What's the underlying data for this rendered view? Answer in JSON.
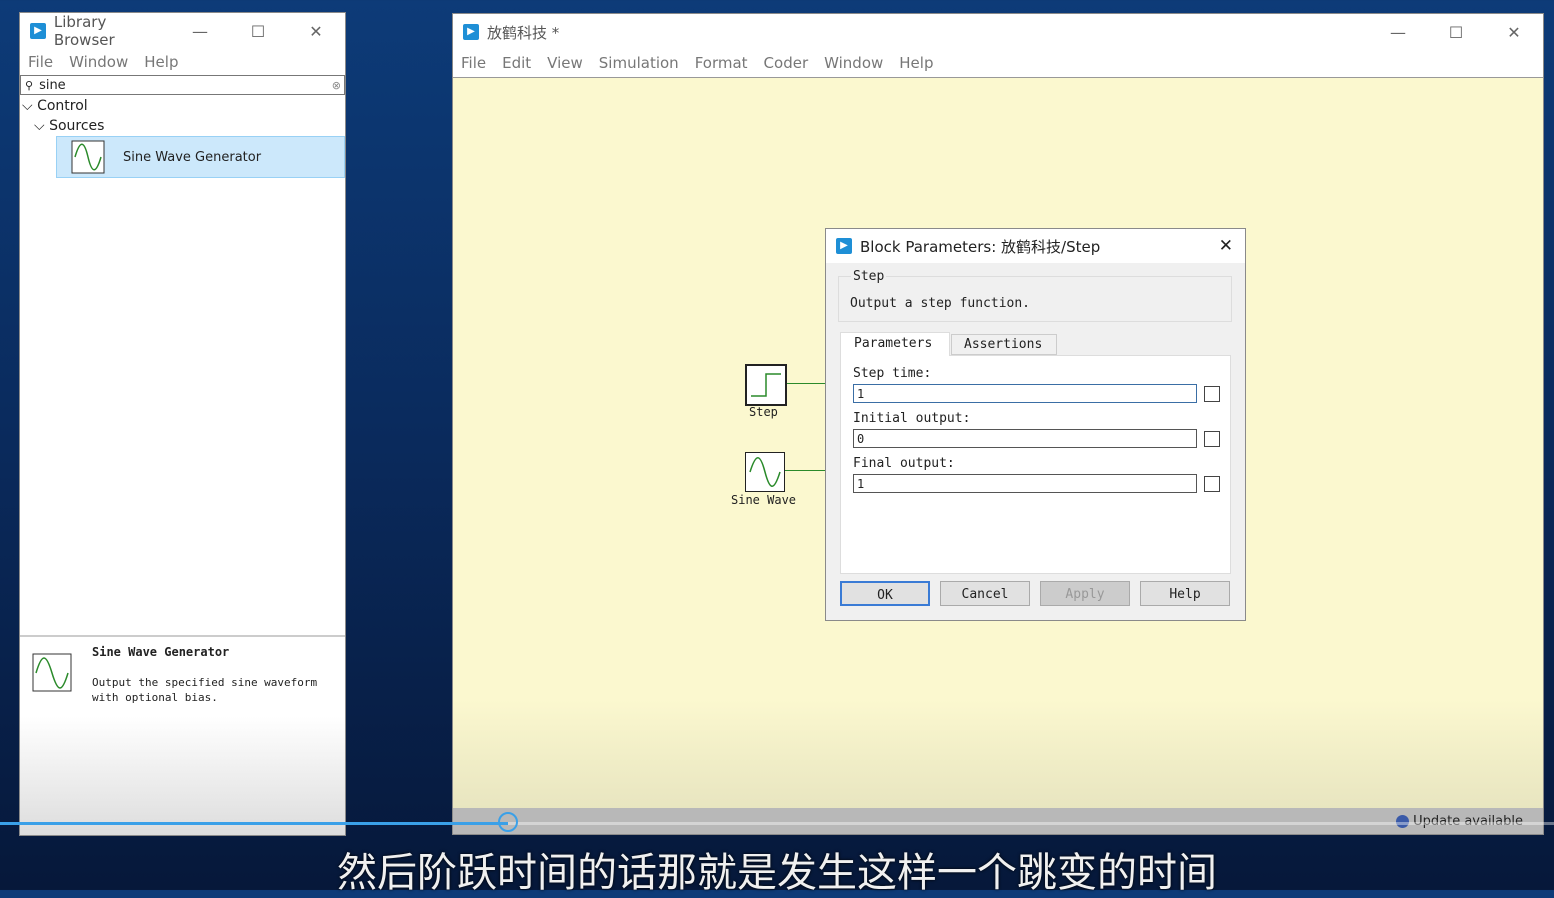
{
  "library": {
    "title": "Library Browser",
    "menu": [
      "File",
      "Window",
      "Help"
    ],
    "search": "sine",
    "tree": {
      "control": "Control",
      "sources": "Sources",
      "item": "Sine Wave Generator"
    },
    "desc_title": "Sine Wave Generator",
    "desc_text": "Output the specified sine waveform with optional bias."
  },
  "model": {
    "title": "放鹤科技 *",
    "menu": [
      "File",
      "Edit",
      "View",
      "Simulation",
      "Format",
      "Coder",
      "Window",
      "Help"
    ],
    "blocks": {
      "step": "Step",
      "sine": "Sine Wave"
    },
    "status": "Update available",
    "canvas_color": "#fbf8cf"
  },
  "dialog": {
    "title": "Block Parameters: 放鹤科技/Step",
    "group": "Step",
    "description": "Output a step function.",
    "tabs": [
      "Parameters",
      "Assertions"
    ],
    "fields": [
      {
        "label": "Step time:",
        "value": "1"
      },
      {
        "label": "Initial output:",
        "value": "0"
      },
      {
        "label": "Final output:",
        "value": "1"
      }
    ],
    "buttons": {
      "ok": "OK",
      "cancel": "Cancel",
      "apply": "Apply",
      "help": "Help"
    }
  },
  "subtitle": "然后阶跃时间的话那就是发生这样一个跳变的时间",
  "video": {
    "progress_percent": 32.7
  }
}
